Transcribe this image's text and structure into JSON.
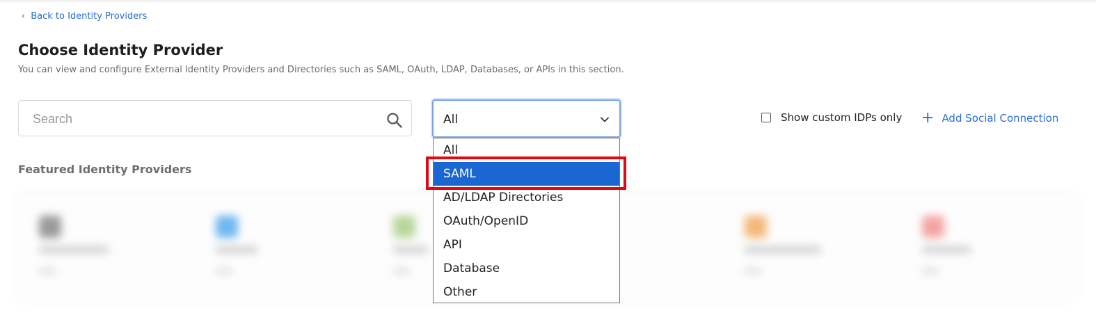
{
  "nav": {
    "back_label": "Back to Identity Providers"
  },
  "header": {
    "title": "Choose Identity Provider",
    "subtitle": "You can view and configure External Identity Providers and Directories such as SAML, OAuth, LDAP, Databases, or APIs in this section."
  },
  "search": {
    "placeholder": "Search",
    "value": ""
  },
  "filter": {
    "selected": "All",
    "options": [
      "All",
      "SAML",
      "AD/LDAP Directories",
      "OAuth/OpenID",
      "API",
      "Database",
      "Other"
    ],
    "highlighted_option": "SAML"
  },
  "toolbar": {
    "custom_only_label": "Show custom IDPs only",
    "custom_only_checked": false,
    "add_social_label": "Add Social Connection"
  },
  "featured": {
    "heading": "Featured Identity Providers"
  },
  "colors": {
    "accent": "#2a6fd6",
    "selected_option_bg": "#1a66d2",
    "annotation_red": "#e30613"
  }
}
